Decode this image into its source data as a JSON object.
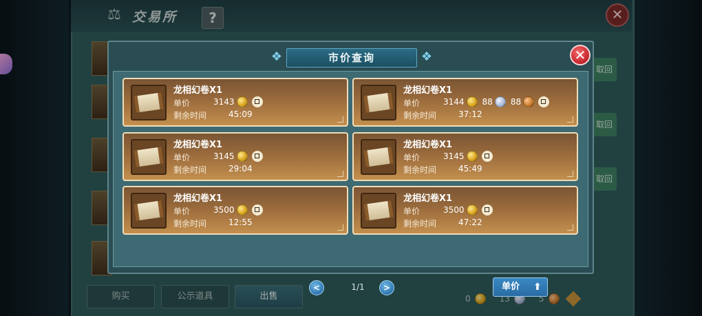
{
  "main": {
    "title": "交易所",
    "help_label": "?",
    "close_label": "✕",
    "fetch_label": "取回",
    "tabs": [
      {
        "label": "购买"
      },
      {
        "label": "公示道具"
      },
      {
        "label": "出售"
      }
    ],
    "currency": {
      "gold": "0",
      "silver": "13",
      "copper": "5"
    }
  },
  "popup": {
    "title": "市价查询",
    "close_label": "✕",
    "price_label": "单价",
    "time_label": "剩余时间",
    "items": [
      {
        "name": "龙相幻卷X1",
        "price": "3143",
        "extra": [],
        "time": "45:09"
      },
      {
        "name": "龙相幻卷X1",
        "price": "3144",
        "extra": [
          {
            "value": "88",
            "coin": "silver"
          },
          {
            "value": "88",
            "coin": "copper"
          }
        ],
        "time": "37:12"
      },
      {
        "name": "龙相幻卷X1",
        "price": "3145",
        "extra": [],
        "time": "29:04"
      },
      {
        "name": "龙相幻卷X1",
        "price": "3145",
        "extra": [],
        "time": "45:49"
      },
      {
        "name": "龙相幻卷X1",
        "price": "3500",
        "extra": [],
        "time": "12:55"
      },
      {
        "name": "龙相幻卷X1",
        "price": "3500",
        "extra": [],
        "time": "47:22"
      }
    ],
    "page_indicator": "1/1",
    "prev_label": "<",
    "next_label": ">",
    "sort_label": "单价"
  }
}
